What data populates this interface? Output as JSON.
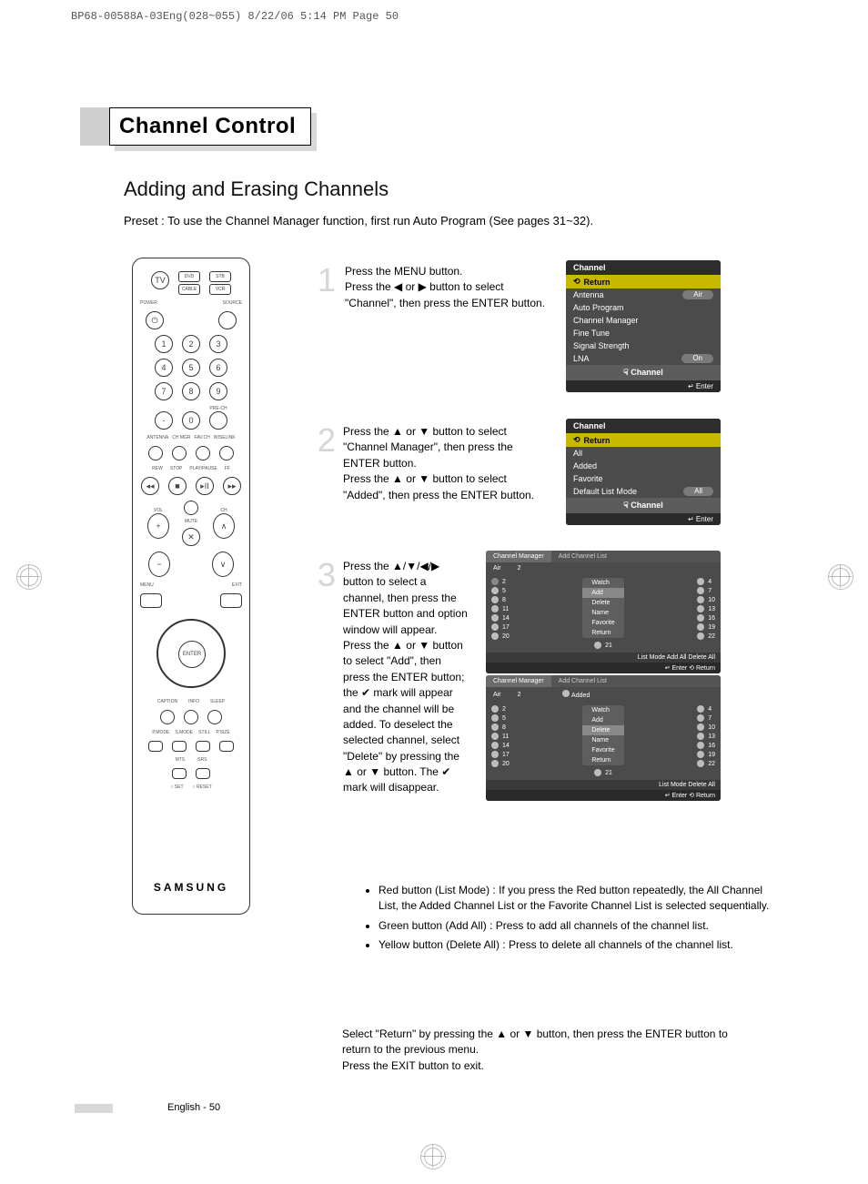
{
  "meta": {
    "print_header": "BP68-00588A-03Eng(028~055)  8/22/06  5:14 PM  Page 50"
  },
  "title": "Channel Control",
  "subhead": "Adding and Erasing Channels",
  "preset": "Preset : To use the Channel Manager function, first run Auto Program (See pages 31~32).",
  "remote": {
    "brand": "SAMSUNG",
    "top_row": [
      "DVD",
      "STB",
      "CABLE",
      "VCR"
    ],
    "tv": "TV",
    "power": "POWER",
    "source": "SOURCE",
    "numpad": [
      "1",
      "2",
      "3",
      "4",
      "5",
      "6",
      "7",
      "8",
      "9",
      "-",
      "0"
    ],
    "prech": "PRE-CH",
    "row1": [
      "ANTENNA",
      "CH MGR",
      "FAV.CH",
      "WISELINK"
    ],
    "trans": [
      "REW",
      "STOP",
      "PLAY/PAUSE",
      "FF"
    ],
    "vol": "VOL",
    "ch": "CH",
    "mute": "MUTE",
    "menu": "MENU",
    "exit": "EXIT",
    "enter": "ENTER",
    "row2": [
      "CAPTION",
      "INFO",
      "SLEEP"
    ],
    "row3": [
      "P.MODE",
      "S.MODE",
      "STILL",
      "P.SIZE"
    ],
    "row4": [
      "MTS",
      "SRS"
    ],
    "setreset": [
      "SET",
      "RESET"
    ]
  },
  "steps": {
    "s1": "Press the MENU button.\nPress the ◀ or ▶ button to select \"Channel\", then press the ENTER button.",
    "s2": "Press the ▲ or ▼ button to select \"Channel Manager\", then press the ENTER button.\nPress the ▲ or ▼ button to select \"Added\", then press the ENTER button.",
    "s3": "Press the ▲/▼/◀/▶ button to select a channel, then press the ENTER button and option window will appear.\nPress the ▲ or ▼ button to select \"Add\", then press the ENTER button; the ✔ mark will appear and the channel will be added. To deselect the selected channel, select \"Delete\" by pressing the ▲ or ▼ button. The ✔ mark will disappear."
  },
  "bullets": [
    "Red button (List Mode) : If you press the Red button repeatedly, the All Channel List, the Added Channel List or the Favorite Channel List is selected sequentially.",
    "Green button (Add All) : Press to add all channels of the channel list.",
    "Yellow button (Delete All) : Press to delete all channels of the channel list."
  ],
  "select_return": "Select \"Return\" by pressing the ▲ or ▼ button, then press the ENTER button to return to the previous menu.\nPress the EXIT button to exit.",
  "osd1": {
    "title": "Channel",
    "return": "Return",
    "rows": [
      {
        "k": "Antenna",
        "v": "Air"
      },
      {
        "k": "Auto Program",
        "v": ""
      },
      {
        "k": "Channel Manager",
        "v": ""
      },
      {
        "k": "Fine Tune",
        "v": ""
      },
      {
        "k": "Signal Strength",
        "v": ""
      },
      {
        "k": "LNA",
        "v": "On"
      }
    ],
    "center": "Channel",
    "foot": "↵ Enter"
  },
  "osd2": {
    "title": "Channel",
    "return": "Return",
    "rows": [
      {
        "k": "All",
        "v": ""
      },
      {
        "k": "Added",
        "v": ""
      },
      {
        "k": "Favorite",
        "v": ""
      },
      {
        "k": "Default List Mode",
        "v": "All"
      }
    ],
    "center": "Channel",
    "foot": "↵ Enter"
  },
  "grid1": {
    "t1": "Channel Manager",
    "t2": "Add Channel List",
    "air": "Air",
    "airval": "2",
    "left_channels": [
      "2",
      "5",
      "8",
      "11",
      "14",
      "17",
      "20"
    ],
    "menu": [
      "Watch",
      "Add",
      "Delete",
      "Name",
      "Favorite",
      "Return"
    ],
    "menu_sel": "Add",
    "mid_val": "21",
    "right_channels": [
      "4",
      "7",
      "10",
      "13",
      "16",
      "19",
      "22"
    ],
    "foot1": "List Mode     Add All     Delete All",
    "foot2": "↵ Enter       ⟲ Return"
  },
  "grid2": {
    "t1": "Channel Manager",
    "t2": "Add Channel List",
    "air": "Air",
    "airval": "2",
    "added": "Added",
    "left_channels": [
      "2",
      "5",
      "8",
      "11",
      "14",
      "17",
      "20"
    ],
    "menu": [
      "Watch",
      "Add",
      "Delete",
      "Name",
      "Favorite",
      "Return"
    ],
    "menu_sel": "Delete",
    "mid_val": "21",
    "right_channels": [
      "4",
      "7",
      "10",
      "13",
      "16",
      "19",
      "22"
    ],
    "foot1": "List Mode     Delete All",
    "foot2": "↵ Enter       ⟲ Return"
  },
  "footer": "English - 50"
}
